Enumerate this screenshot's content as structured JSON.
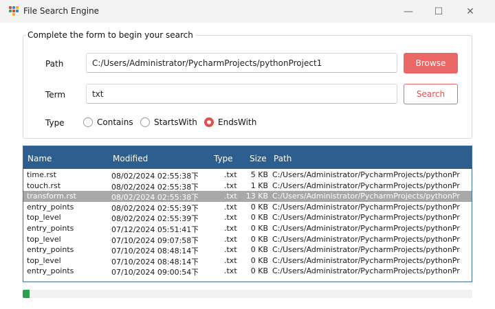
{
  "window": {
    "title": "File Search Engine",
    "controls": {
      "minimize": "—",
      "maximize": "☐",
      "close": "✕"
    }
  },
  "form": {
    "legend": "Complete the form to begin your search",
    "path_label": "Path",
    "path_value": "C:/Users/Administrator/PycharmProjects/pythonProject1",
    "browse_label": "Browse",
    "term_label": "Term",
    "term_value": "txt",
    "search_label": "Search",
    "type_label": "Type",
    "type_options": [
      {
        "label": "Contains",
        "selected": false
      },
      {
        "label": "StartsWith",
        "selected": false
      },
      {
        "label": "EndsWith",
        "selected": true
      }
    ]
  },
  "table": {
    "columns": [
      "Name",
      "Modified",
      "Type",
      "Size",
      "Path"
    ],
    "rows": [
      {
        "name": "time.rst",
        "modified": "08/02/2024 02:55:38下",
        "type": ".txt",
        "size": "5 KB",
        "path": "C:/Users/Administrator/PycharmProjects/pythonPr",
        "selected": false
      },
      {
        "name": "touch.rst",
        "modified": "08/02/2024 02:55:38下",
        "type": ".txt",
        "size": "1 KB",
        "path": "C:/Users/Administrator/PycharmProjects/pythonPr",
        "selected": false
      },
      {
        "name": "transform.rst",
        "modified": "08/02/2024 02:55:38下",
        "type": ".txt",
        "size": "13 KB",
        "path": "C:/Users/Administrator/PycharmProjects/pythonPr",
        "selected": true
      },
      {
        "name": "entry_points",
        "modified": "08/02/2024 02:55:39下",
        "type": ".txt",
        "size": "0 KB",
        "path": "C:/Users/Administrator/PycharmProjects/pythonPr",
        "selected": false
      },
      {
        "name": "top_level",
        "modified": "08/02/2024 02:55:39下",
        "type": ".txt",
        "size": "0 KB",
        "path": "C:/Users/Administrator/PycharmProjects/pythonPr",
        "selected": false
      },
      {
        "name": "entry_points",
        "modified": "07/12/2024 05:51:41下",
        "type": ".txt",
        "size": "0 KB",
        "path": "C:/Users/Administrator/PycharmProjects/pythonPr",
        "selected": false
      },
      {
        "name": "top_level",
        "modified": "07/10/2024 09:07:58下",
        "type": ".txt",
        "size": "0 KB",
        "path": "C:/Users/Administrator/PycharmProjects/pythonPr",
        "selected": false
      },
      {
        "name": "entry_points",
        "modified": "07/10/2024 08:48:14下",
        "type": ".txt",
        "size": "0 KB",
        "path": "C:/Users/Administrator/PycharmProjects/pythonPr",
        "selected": false
      },
      {
        "name": "top_level",
        "modified": "07/10/2024 08:48:14下",
        "type": ".txt",
        "size": "0 KB",
        "path": "C:/Users/Administrator/PycharmProjects/pythonPr",
        "selected": false
      },
      {
        "name": "entry_points",
        "modified": "07/10/2024 09:00:54下",
        "type": ".txt",
        "size": "0 KB",
        "path": "C:/Users/Administrator/PycharmProjects/pythonPr",
        "selected": false
      }
    ]
  },
  "progress": {
    "fraction": 0.015
  },
  "colors": {
    "accent": "#e96767",
    "header": "#2d5e8e",
    "selected_row": "#a8a8a8",
    "progress": "#2aa24a"
  },
  "icons": {
    "app": "app-dots-icon",
    "radio": "radio-icon"
  }
}
